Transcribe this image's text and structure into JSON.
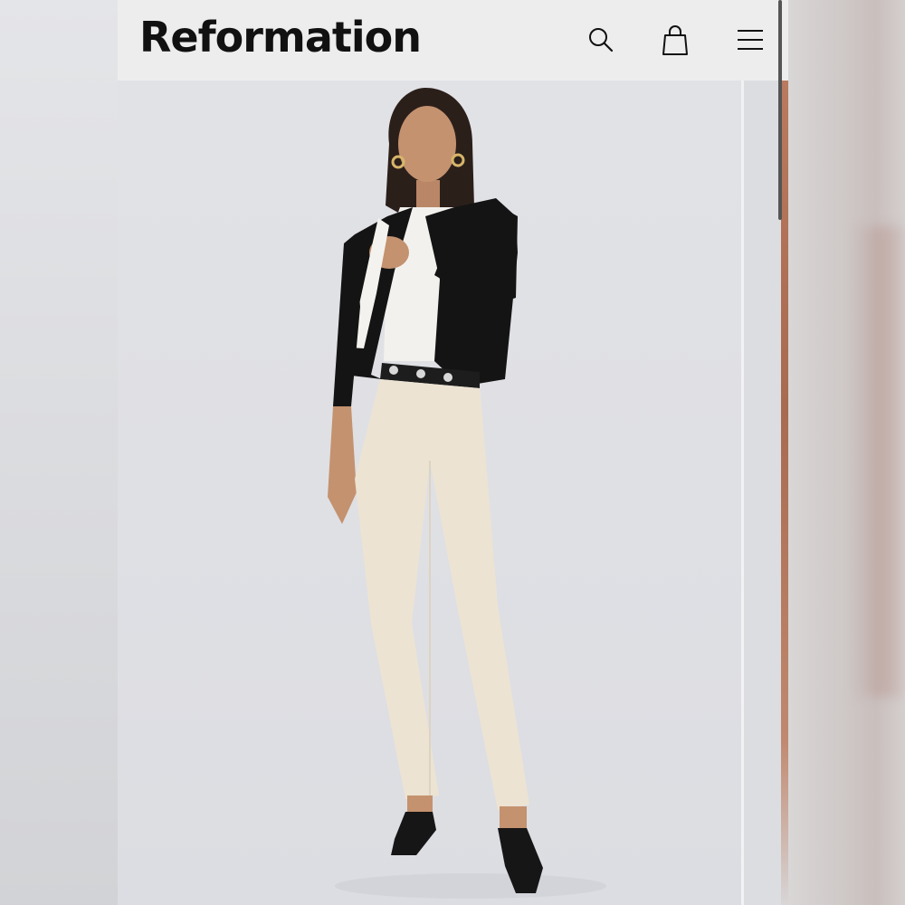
{
  "header": {
    "logo_text": "Reformation",
    "icons": [
      "search-icon",
      "shopping-bag-icon",
      "menu-icon"
    ]
  },
  "product_image": {
    "alt": ""
  },
  "colors": {
    "header_bg": "#ededed",
    "logo": "#111111",
    "cardigan": "#141414",
    "pants": "#ece3d3"
  }
}
